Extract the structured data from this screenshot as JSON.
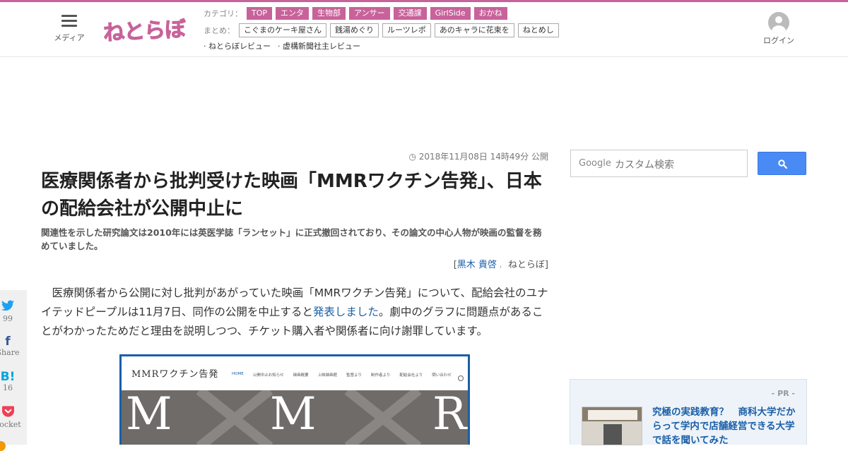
{
  "header": {
    "menu_label": "メディア",
    "logo_text": "ねとらぼ",
    "category_label": "カテゴリ：",
    "categories": [
      "TOP",
      "エンタ",
      "生物部",
      "アンサー",
      "交通課",
      "GirlSide",
      "おかね"
    ],
    "summary_label": "まとめ：",
    "summaries": [
      "こぐまのケーキ屋さん",
      "銭湯めぐり",
      "ルーツレポ",
      "あのキャラに花束を",
      "ねとめし"
    ],
    "reviews": [
      "· ねとらぼレビュー",
      "· 虚構新聞社主レビュー"
    ],
    "login_label": "ログイン"
  },
  "article": {
    "date": "2018年11月08日 14時49分 公開",
    "title": "医療関係者から批判受けた映画「MMRワクチン告発」、日本の配給会社が公開中止に",
    "subtitle": "関連性を示した研究論文は2010年には英医学誌「ランセット」に正式撤回されており、その論文の中心人物が映画の監督を務めていました。",
    "byline_open": "[",
    "author": "黒木 貴啓",
    "byline_sep": "，",
    "publisher": "ねとらぼ",
    "byline_close": "]",
    "body_before": "　医療関係者から公開に対し批判があがっていた映画「MMRワクチン告発」について、配給会社のユナイテッドピープルは11月7日、同作の公開を中止すると",
    "body_link": "発表しました",
    "body_after": "。劇中のグラフに問題点があることがわかったためだと理由を説明しつつ、チケット購入者や関係者に向け謝罪しています。"
  },
  "screenshot": {
    "logo": "MMRワクチン告発",
    "nav": [
      "HOME",
      "公開中止お知らせ",
      "映画概要",
      "上映映画館",
      "監督より",
      "制作者より",
      "配給会社より",
      "問い合わせ"
    ],
    "hero_letters": [
      "M",
      "M",
      "R"
    ]
  },
  "share": {
    "twitter_count": "99",
    "facebook_label": "Share",
    "hatena_count": "16",
    "pocket_label": "Pocket"
  },
  "search": {
    "brand": "Google",
    "placeholder": "カスタム検索"
  },
  "pr": {
    "label": "- PR -",
    "title": "究極の実践教育？　商科大学だからって学内で店舗経営できる大学で話を聞いてみた"
  },
  "colors": {
    "brand_pink": "#c8629a",
    "link_blue": "#1a5fa8",
    "search_blue": "#4a8af4",
    "twitter": "#1da1f2",
    "facebook": "#3b5998",
    "hatena": "#00a4de",
    "pocket": "#ef4056"
  }
}
